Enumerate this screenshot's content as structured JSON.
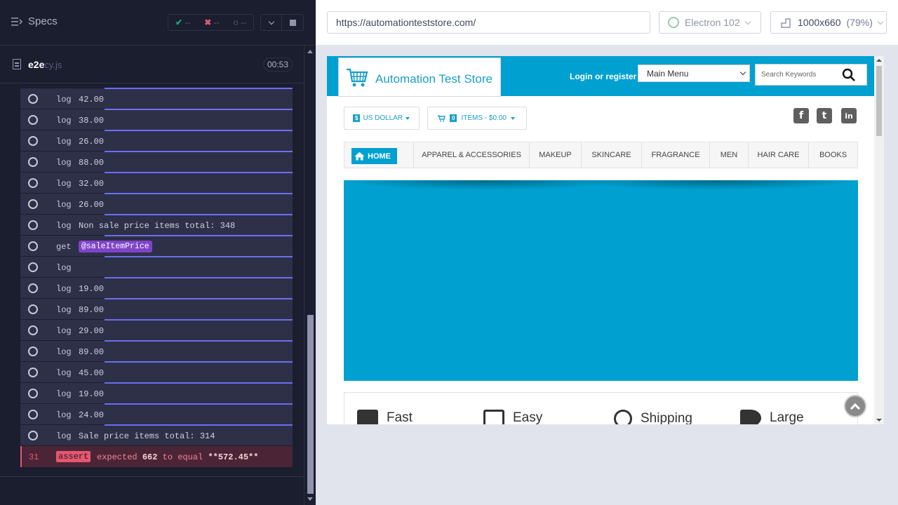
{
  "reporter": {
    "specs_label": "Specs",
    "stats": {
      "passed": "--",
      "failed": "--",
      "pending": "--"
    },
    "spec_name": "e2e",
    "spec_ext": "cy.js",
    "duration": "00:53",
    "commands": [
      {
        "name": "log",
        "message": "42.00"
      },
      {
        "name": "log",
        "message": "38.00"
      },
      {
        "name": "log",
        "message": "26.00"
      },
      {
        "name": "log",
        "message": "88.00"
      },
      {
        "name": "log",
        "message": "32.00"
      },
      {
        "name": "log",
        "message": "26.00"
      },
      {
        "name": "log",
        "message": "Non sale price items total: 348"
      },
      {
        "name": "get",
        "alias": "@saleItemPrice"
      },
      {
        "name": "log",
        "message": ""
      },
      {
        "name": "log",
        "message": "19.00"
      },
      {
        "name": "log",
        "message": "89.00"
      },
      {
        "name": "log",
        "message": "29.00"
      },
      {
        "name": "log",
        "message": "89.00"
      },
      {
        "name": "log",
        "message": "45.00"
      },
      {
        "name": "log",
        "message": "19.00"
      },
      {
        "name": "log",
        "message": "24.00"
      },
      {
        "name": "log",
        "message": "Sale price items total: 314"
      }
    ],
    "assert": {
      "number": "31",
      "keyword": "assert",
      "word_expected": "expected",
      "actual": "662",
      "word_to_equal": "to equal",
      "expected": "**572.45**"
    }
  },
  "aut": {
    "url": "https://automationteststore.com/",
    "browser": "Electron 102",
    "viewport": "1000x660",
    "zoom": "(79%)"
  },
  "site": {
    "logo_text": "Automation Test Store",
    "login_link": "Login or register",
    "menu_select": "Main Menu",
    "search_placeholder": "Search Keywords",
    "currency_symbol": "$",
    "currency": "US DOLLAR",
    "cart_count": "0",
    "cart_label": "ITEMS - $0.00",
    "social": [
      "f",
      "t",
      "in"
    ],
    "nav_home": "HOME",
    "nav": [
      "APPAREL & ACCESSORIES",
      "MAKEUP",
      "SKINCARE",
      "FRAGRANCE",
      "MEN",
      "HAIR CARE",
      "BOOKS"
    ],
    "features": [
      "Fast",
      "Easy",
      "Shipping",
      "Large"
    ],
    "colors": {
      "brand": "#00a0d0",
      "reporter_bg": "#1b1e2e",
      "command_bg": "#2d3047",
      "fail": "#e45770",
      "alias": "#7f43c9"
    }
  }
}
